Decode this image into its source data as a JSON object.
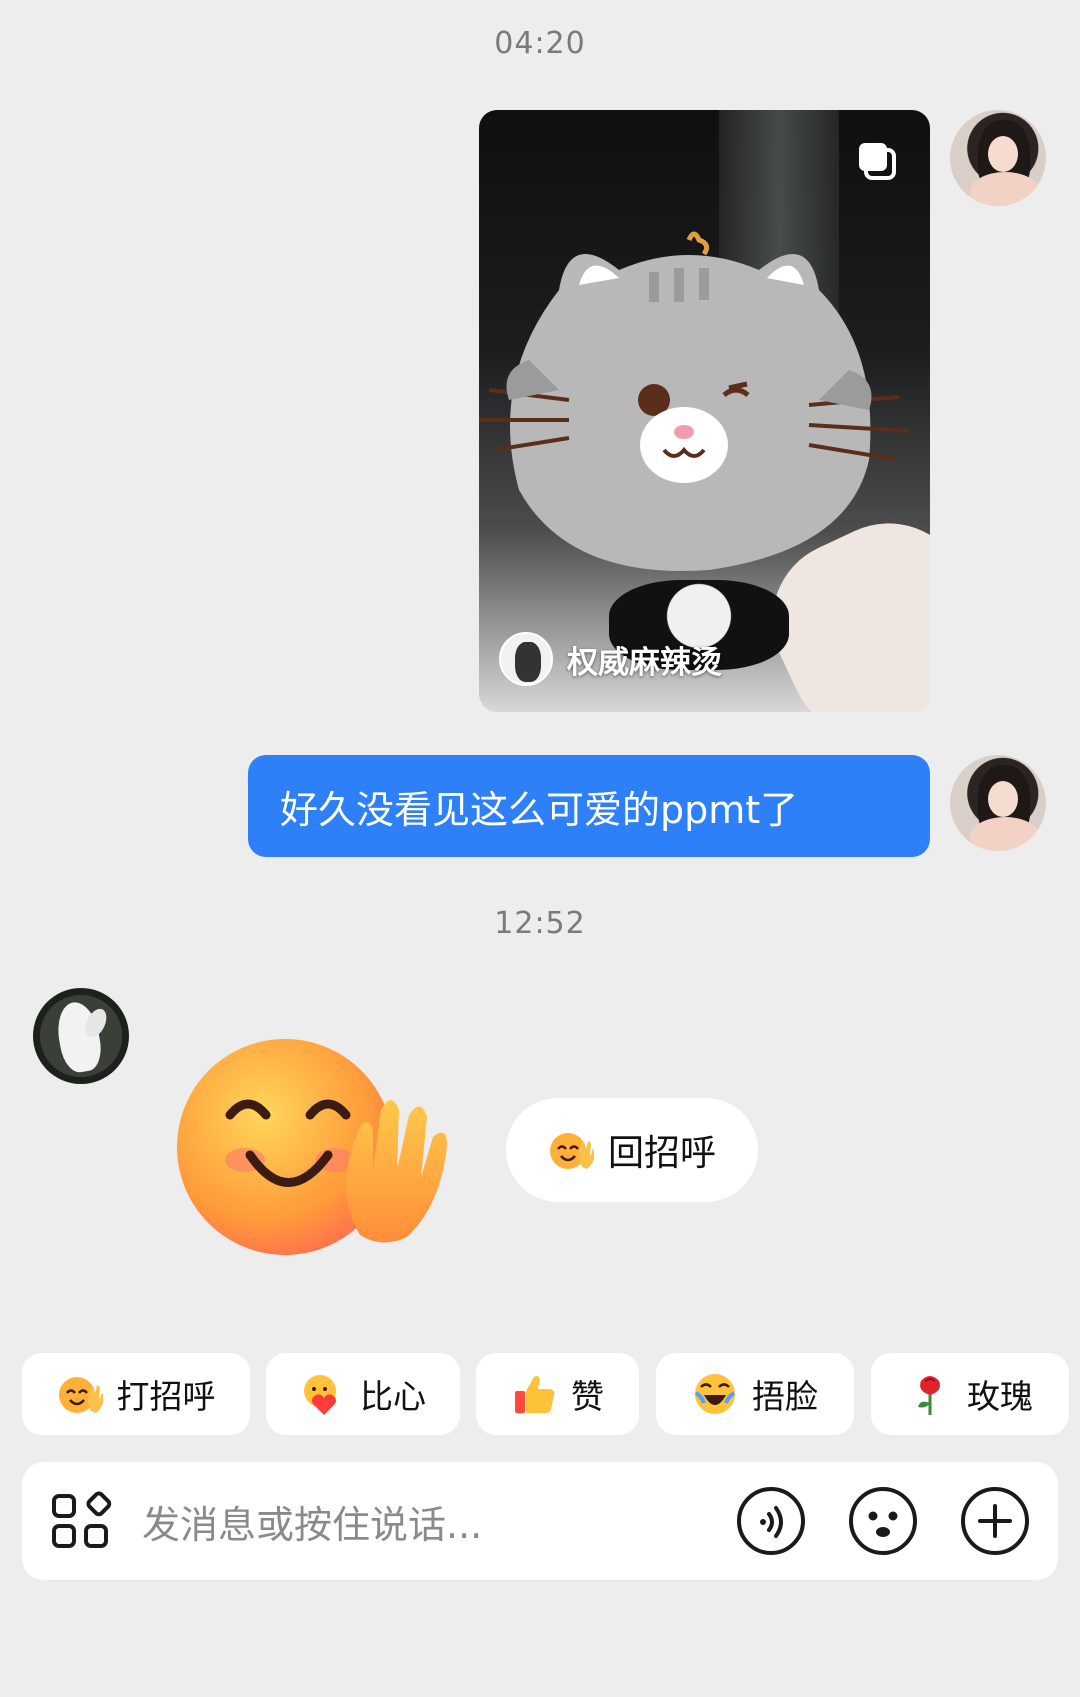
{
  "timestamps": {
    "first": "04:20",
    "second": "12:52"
  },
  "shared_video": {
    "author_name": "权威麻辣烫",
    "multi_icon": "stack-icon"
  },
  "outgoing_message": {
    "text": "好久没看见这么可爱的ppmt了"
  },
  "incoming": {
    "sticker": "smile-wave-emoji",
    "reply_button_label": "回招呼"
  },
  "quick_replies": [
    {
      "label": "打招呼",
      "icon": "wave-emoji"
    },
    {
      "label": "比心",
      "icon": "heart-hands-emoji"
    },
    {
      "label": "赞",
      "icon": "thumbs-up-emoji"
    },
    {
      "label": "捂脸",
      "icon": "facepalm-laugh-emoji"
    },
    {
      "label": "玫瑰",
      "icon": "rose-emoji"
    }
  ],
  "composer": {
    "placeholder": "发消息或按住说话...",
    "left_icon": "apps-icon",
    "right_icons": [
      "voice-icon",
      "emoji-icon",
      "plus-icon"
    ]
  },
  "colors": {
    "background": "#ededed",
    "bubble_out": "#2d80f7"
  }
}
